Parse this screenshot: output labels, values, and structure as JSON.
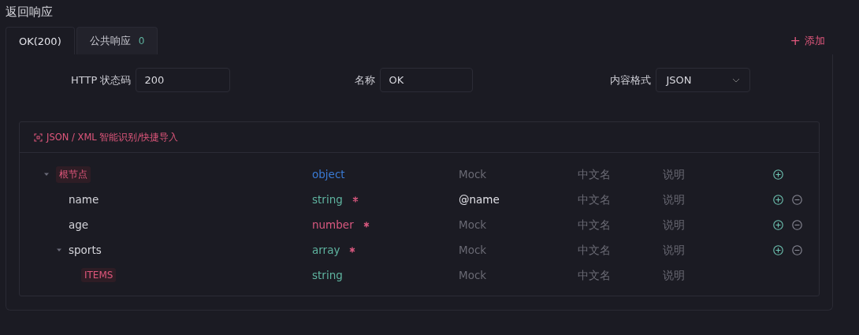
{
  "section_title": "返回响应",
  "tabs": [
    {
      "label": "OK(200)",
      "selected": true
    },
    {
      "label": "公共响应",
      "count": "0",
      "selected": false
    }
  ],
  "add_button": {
    "icon": "+",
    "label": "添加"
  },
  "form": {
    "status": {
      "label": "HTTP 状态码",
      "value": "200"
    },
    "name": {
      "label": "名称",
      "value": "OK"
    },
    "format": {
      "label": "内容格式",
      "value": "JSON"
    }
  },
  "schema": {
    "import_label": "JSON / XML 智能识别/快捷导入",
    "nodes": [
      {
        "kind": "root",
        "name": "根节点",
        "expanded": true,
        "type": "object",
        "color": "#3a7bd5",
        "required": false,
        "mock": {
          "placeholder": "Mock"
        },
        "title_placeholder": "中文名",
        "desc_placeholder": "说明",
        "can_add": true,
        "can_remove": false,
        "children": [
          {
            "kind": "field",
            "name": "name",
            "type": "string",
            "color": "#5fb4a0",
            "required": true,
            "mock": {
              "value": "@name"
            },
            "title_placeholder": "中文名",
            "desc_placeholder": "说明",
            "can_add": true,
            "can_remove": true
          },
          {
            "kind": "field",
            "name": "age",
            "type": "number",
            "color": "#d9587f",
            "required": true,
            "mock": {
              "placeholder": "Mock"
            },
            "title_placeholder": "中文名",
            "desc_placeholder": "说明",
            "can_add": true,
            "can_remove": true
          },
          {
            "kind": "field",
            "name": "sports",
            "expanded": true,
            "type": "array",
            "color": "#5fb4a0",
            "required": true,
            "mock": {
              "placeholder": "Mock"
            },
            "title_placeholder": "中文名",
            "desc_placeholder": "说明",
            "can_add": true,
            "can_remove": true,
            "children": [
              {
                "kind": "items",
                "name": "ITEMS",
                "type": "string",
                "color": "#5fb4a0",
                "required": false,
                "mock": {
                  "placeholder": "Mock"
                },
                "title_placeholder": "中文名",
                "desc_placeholder": "说明",
                "can_add": false,
                "can_remove": false
              }
            ]
          }
        ]
      }
    ]
  }
}
